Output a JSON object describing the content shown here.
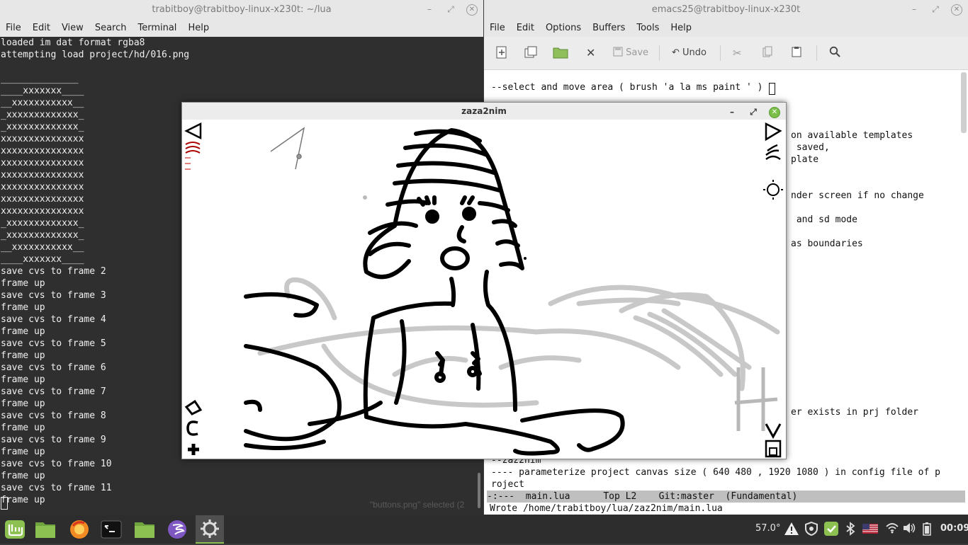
{
  "terminal": {
    "title": "trabitboy@trabitboy-linux-x230t: ~/lua",
    "menu": [
      "File",
      "Edit",
      "View",
      "Search",
      "Terminal",
      "Help"
    ],
    "lines": [
      "loaded im dat format rgba8",
      "attempting load project/hd/016.png",
      "",
      "______________",
      "____xxxxxxx____",
      "__xxxxxxxxxxx__",
      "_xxxxxxxxxxxxx_",
      "_xxxxxxxxxxxxx_",
      "xxxxxxxxxxxxxxx",
      "xxxxxxxxxxxxxxx",
      "xxxxxxxxxxxxxxx",
      "xxxxxxxxxxxxxxx",
      "xxxxxxxxxxxxxxx",
      "xxxxxxxxxxxxxxx",
      "xxxxxxxxxxxxxxx",
      "_xxxxxxxxxxxxx_",
      "_xxxxxxxxxxxxx_",
      "__xxxxxxxxxxx__",
      "____xxxxxxx____",
      "save cvs to frame 2",
      "frame up",
      "save cvs to frame 3",
      "frame up",
      "save cvs to frame 4",
      "frame up",
      "save cvs to frame 5",
      "frame up",
      "save cvs to frame 6",
      "frame up",
      "save cvs to frame 7",
      "frame up",
      "save cvs to frame 8",
      "frame up",
      "save cvs to frame 9",
      "frame up",
      "save cvs to frame 10",
      "frame up",
      "save cvs to frame 11",
      "frame up"
    ],
    "ghost_status": "\"buttons.png\" selected (2"
  },
  "emacs": {
    "title": "emacs25@trabitboy-linux-x230t",
    "menu": [
      "File",
      "Edit",
      "Options",
      "Buffers",
      "Tools",
      "Help"
    ],
    "toolbar": {
      "save": "Save",
      "undo": "Undo"
    },
    "code_top": "--select and move area ( brush 'a la ms paint ' )",
    "code_fragments": [
      "on available templates",
      " saved,",
      "plate",
      "nder screen if no change",
      " and sd mode",
      "as boundaries",
      "er exists in prj folder"
    ],
    "code_bottom": [
      "--zaz2nim",
      "---- parameterize project canvas size ( 640 480 , 1920 1080 ) in config file of p",
      "roject"
    ],
    "modeline": "-:---  main.lua      Top L2    Git:master  (Fundamental)",
    "minibuffer": "Wrote /home/trabitboy/lua/zaz2nim/main.lua"
  },
  "zaza": {
    "title": "zaza2nim"
  },
  "taskbar": {
    "temperature": "57.0°",
    "clock": "00:09"
  }
}
